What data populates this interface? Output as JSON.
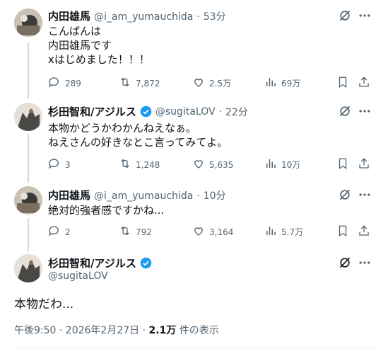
{
  "tweets": [
    {
      "name": "内田雄馬",
      "handle": "@i_am_yumauchida",
      "sep": "·",
      "time": "53分",
      "text": "こんばんは\n内田雄馬です\nxはじめました！！！",
      "replies": "289",
      "retweets": "7,872",
      "likes": "2.5万",
      "views": "69万"
    },
    {
      "name": "杉田智和/アジルス",
      "handle": "@sugitaLOV",
      "sep": "·",
      "time": "22分",
      "text": "本物かどうかわかんねえなぁ。\nねえさんの好きなとこ言ってみてよ。",
      "replies": "3",
      "retweets": "1,248",
      "likes": "5,635",
      "views": "10万"
    },
    {
      "name": "内田雄馬",
      "handle": "@i_am_yumauchida",
      "sep": "·",
      "time": "10分",
      "text": "絶対的強者感ですかね...",
      "replies": "2",
      "retweets": "792",
      "likes": "3,164",
      "views": "5.7万"
    }
  ],
  "main": {
    "name": "杉田智和/アジルス",
    "handle": "@sugitaLOV",
    "text": "本物だわ...",
    "timestamp": "午後9:50 · 2026年2月27日 · ",
    "views": "2.1万",
    "views_label": " 件の表示"
  },
  "icons": {
    "grok": "grok-icon",
    "more": "more-icon",
    "reply": "reply-icon",
    "retweet": "retweet-icon",
    "like": "like-icon",
    "views": "views-icon",
    "bookmark": "bookmark-icon",
    "share": "share-icon",
    "verified": "verified-badge-icon"
  },
  "colors": {
    "verified": "#1d9bf0",
    "secondary_text": "#536471",
    "divider": "#eff3f4",
    "thread_line": "#cfd9de"
  }
}
